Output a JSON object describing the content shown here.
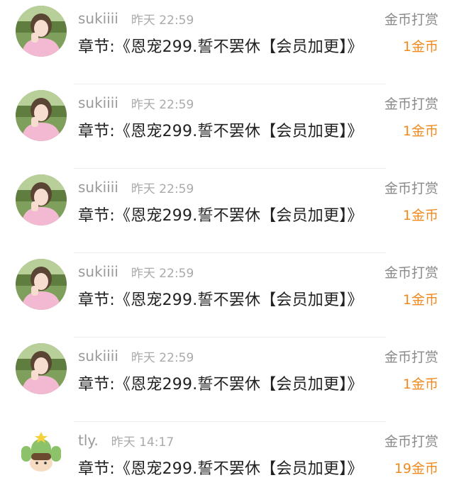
{
  "colors": {
    "username": "#9a9a9a",
    "time": "#aaaaaa",
    "chapter": "#222222",
    "type_label": "#8a8a8a",
    "amount": "#f08a1f",
    "divider": "#efefef"
  },
  "entries": [
    {
      "user": "sukiiii",
      "time": "昨天 22:59",
      "chapter": "章节:《恩宠299.誓不罢休【会员加更】》",
      "type": "金币打赏",
      "amount": "1金币",
      "avatar_icon": "girl-pink-sweater-avatar"
    },
    {
      "user": "sukiiii",
      "time": "昨天 22:59",
      "chapter": "章节:《恩宠299.誓不罢休【会员加更】》",
      "type": "金币打赏",
      "amount": "1金币",
      "avatar_icon": "girl-pink-sweater-avatar"
    },
    {
      "user": "sukiiii",
      "time": "昨天 22:59",
      "chapter": "章节:《恩宠299.誓不罢休【会员加更】》",
      "type": "金币打赏",
      "amount": "1金币",
      "avatar_icon": "girl-pink-sweater-avatar"
    },
    {
      "user": "sukiiii",
      "time": "昨天 22:59",
      "chapter": "章节:《恩宠299.誓不罢休【会员加更】》",
      "type": "金币打赏",
      "amount": "1金币",
      "avatar_icon": "girl-pink-sweater-avatar"
    },
    {
      "user": "sukiiii",
      "time": "昨天 22:59",
      "chapter": "章节:《恩宠299.誓不罢休【会员加更】》",
      "type": "金币打赏",
      "amount": "1金币",
      "avatar_icon": "girl-pink-sweater-avatar"
    },
    {
      "user": "tly.",
      "time": "昨天 14:17",
      "chapter": "章节:《恩宠299.誓不罢休【会员加更】》",
      "type": "金币打赏",
      "amount": "19金币",
      "avatar_icon": "cactus-boy-avatar"
    }
  ]
}
